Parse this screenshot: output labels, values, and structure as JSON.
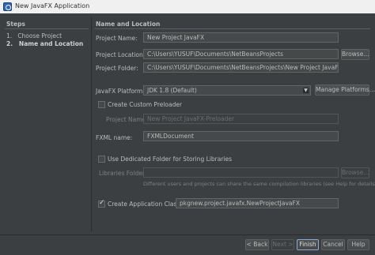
{
  "window": {
    "title": "New JavaFX Application"
  },
  "steps": {
    "header": "Steps",
    "items": [
      {
        "number": "1.",
        "label": "Choose Project"
      },
      {
        "number": "2.",
        "label": "Name and Location"
      }
    ]
  },
  "panel": {
    "header": "Name and Location",
    "project_name": {
      "label": "Project Name:",
      "value": "New Project JavaFX"
    },
    "project_location": {
      "label": "Project Location:",
      "value": "C:\\Users\\YUSUF\\Documents\\NetBeansProjects",
      "browse": "Browse..."
    },
    "project_folder": {
      "label": "Project Folder:",
      "value": "C:\\Users\\YUSUF\\Documents\\NetBeansProjects\\New Project JavaFX"
    },
    "javafx_platform": {
      "label": "JavaFX Platform:",
      "value": "JDK 1.8 (Default)",
      "manage": "Manage Platforms..."
    },
    "custom_preloader": {
      "label": "Create Custom Preloader",
      "checked": false
    },
    "preloader_project_name": {
      "label": "Project Name:",
      "value": "New Project JavaFX-Preloader"
    },
    "fxml_name": {
      "label": "FXML name:",
      "value": "FXMLDocument"
    },
    "dedicated_folder": {
      "label": "Use Dedicated Folder for Storing Libraries",
      "checked": false
    },
    "libraries_folder": {
      "label": "Libraries Folder:",
      "value": "",
      "browse": "Browse..."
    },
    "libraries_info": "Different users and projects can share the same compilation libraries (see Help for details).",
    "create_app_class": {
      "label": "Create Application Class",
      "checked": true,
      "value": "pkgnew.project.javafx.NewProjectJavaFX"
    }
  },
  "buttons": {
    "back": "< Back",
    "next": "Next >",
    "finish": "Finish",
    "cancel": "Cancel",
    "help": "Help"
  }
}
